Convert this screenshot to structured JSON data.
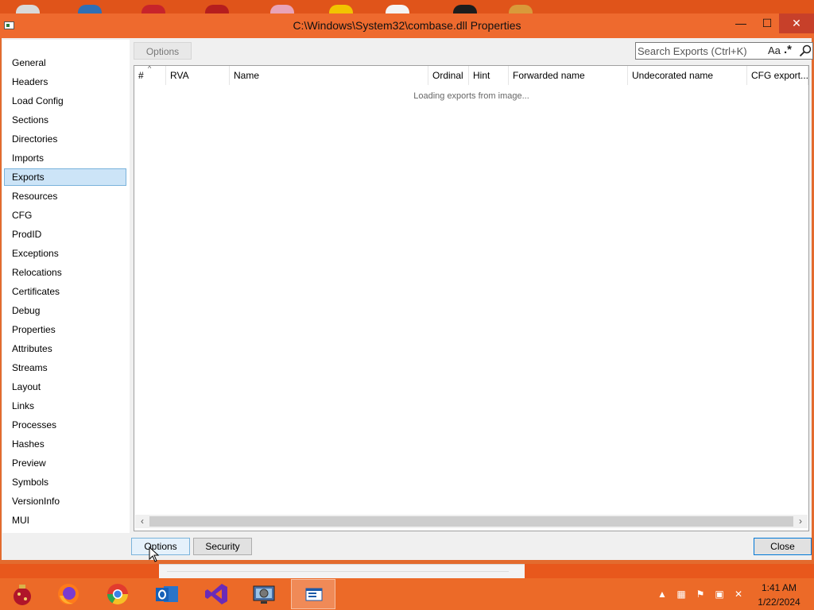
{
  "window": {
    "title": "C:\\Windows\\System32\\combase.dll Properties",
    "minimize_glyph": "—",
    "maximize_glyph": "☐",
    "close_glyph": "✕"
  },
  "sidebar": {
    "selected": "Exports",
    "items": [
      {
        "label": "General"
      },
      {
        "label": "Headers"
      },
      {
        "label": "Load Config"
      },
      {
        "label": "Sections"
      },
      {
        "label": "Directories"
      },
      {
        "label": "Imports"
      },
      {
        "label": "Exports"
      },
      {
        "label": "Resources"
      },
      {
        "label": "CFG"
      },
      {
        "label": "ProdID"
      },
      {
        "label": "Exceptions"
      },
      {
        "label": "Relocations"
      },
      {
        "label": "Certificates"
      },
      {
        "label": "Debug"
      },
      {
        "label": "Properties"
      },
      {
        "label": "Attributes"
      },
      {
        "label": "Streams"
      },
      {
        "label": "Layout"
      },
      {
        "label": "Links"
      },
      {
        "label": "Processes"
      },
      {
        "label": "Hashes"
      },
      {
        "label": "Preview"
      },
      {
        "label": "Symbols"
      },
      {
        "label": "VersionInfo"
      },
      {
        "label": "MUI"
      }
    ]
  },
  "toolbar": {
    "options_label": "Options",
    "search_placeholder": "Search Exports (Ctrl+K)",
    "match_case_label": "Aa",
    "regex_label": ".*",
    "search_icon": "search-icon"
  },
  "exports_table": {
    "sort_indicator": "^",
    "columns": [
      {
        "label": "#"
      },
      {
        "label": "RVA"
      },
      {
        "label": "Name"
      },
      {
        "label": "Ordinal"
      },
      {
        "label": "Hint"
      },
      {
        "label": "Forwarded name"
      },
      {
        "label": "Undecorated name"
      },
      {
        "label": "CFG export..."
      }
    ],
    "rows": [],
    "status_text": "Loading exports from image..."
  },
  "footer": {
    "options_label": "Options",
    "security_label": "Security",
    "close_label": "Close"
  },
  "taskbar": {
    "apps": [
      {
        "name": "start-ornament-icon"
      },
      {
        "name": "firefox-icon"
      },
      {
        "name": "chrome-icon"
      },
      {
        "name": "outlook-icon"
      },
      {
        "name": "visual-studio-icon"
      },
      {
        "name": "system-tool-icon"
      },
      {
        "name": "system-informer-icon"
      }
    ],
    "clock_time": "1:41 AM",
    "clock_date": "1/22/2024"
  },
  "colors": {
    "accent_orange": "#ee6a2e",
    "selection_blue": "#cce4f7",
    "close_red": "#c7402a"
  }
}
